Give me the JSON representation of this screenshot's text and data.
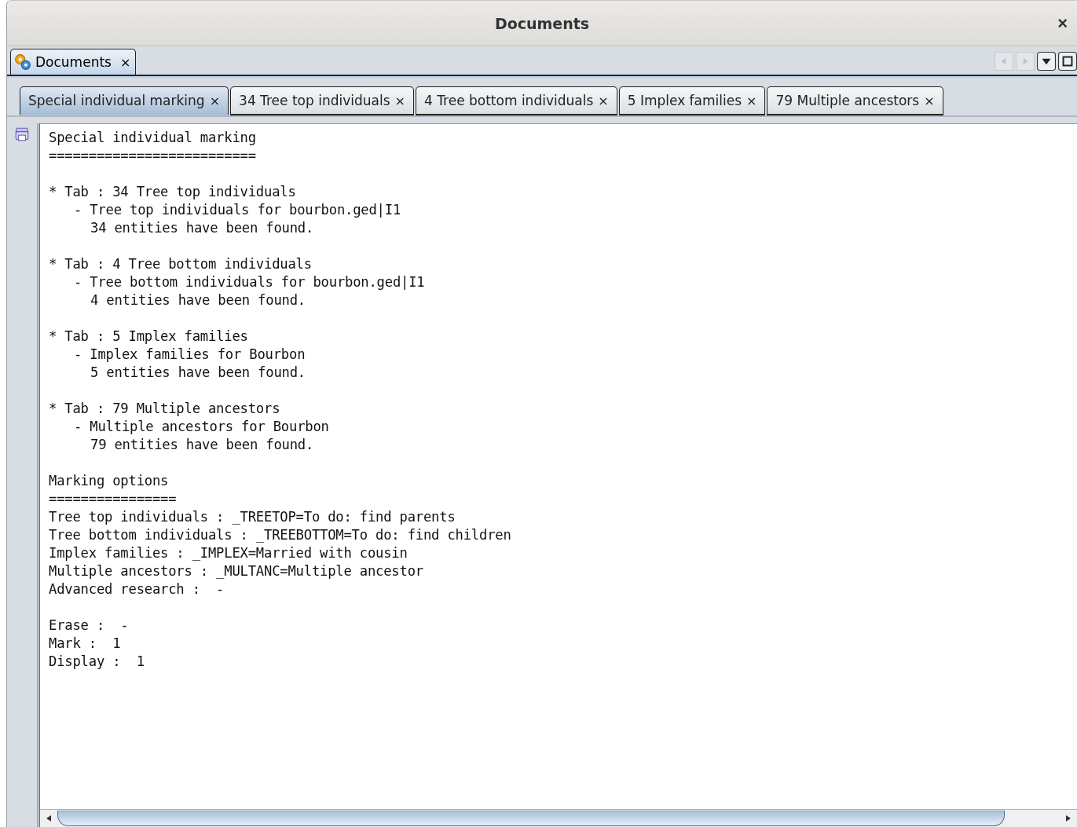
{
  "window": {
    "title": "Documents",
    "close": "×"
  },
  "outer_tabs": [
    {
      "label": "Documents",
      "close": "×",
      "selected": true
    }
  ],
  "tabs": [
    {
      "label": "Special individual marking",
      "close": "×",
      "selected": true
    },
    {
      "label": "34 Tree top individuals",
      "close": "×",
      "selected": false
    },
    {
      "label": "4 Tree bottom individuals",
      "close": "×",
      "selected": false
    },
    {
      "label": "5 Implex families",
      "close": "×",
      "selected": false
    },
    {
      "label": "79 Multiple ancestors",
      "close": "×",
      "selected": false
    }
  ],
  "report": {
    "title": "Special individual marking",
    "underline": "==========================",
    "sections": [
      {
        "header": "* Tab : 34 Tree top individuals",
        "query": "- Tree top individuals for bourbon.ged|I1",
        "result": "34 entities have been found."
      },
      {
        "header": "* Tab : 4 Tree bottom individuals",
        "query": "- Tree bottom individuals for bourbon.ged|I1",
        "result": "4 entities have been found."
      },
      {
        "header": "* Tab : 5 Implex families",
        "query": "- Implex families for Bourbon",
        "result": "5 entities have been found."
      },
      {
        "header": "* Tab : 79 Multiple ancestors",
        "query": "- Multiple ancestors for Bourbon",
        "result": "79 entities have been found."
      }
    ],
    "options_title": "Marking options",
    "options_underline": "================",
    "options": [
      "Tree top individuals : _TREETOP=To do: find parents",
      "Tree bottom individuals : _TREEBOTTOM=To do: find children",
      "Implex families : _IMPLEX=Married with cousin",
      "Multiple ancestors : _MULTANC=Multiple ancestor",
      "Advanced research :  -"
    ],
    "settings": [
      "Erase :  -",
      "Mark :  1",
      "Display :  1"
    ]
  }
}
